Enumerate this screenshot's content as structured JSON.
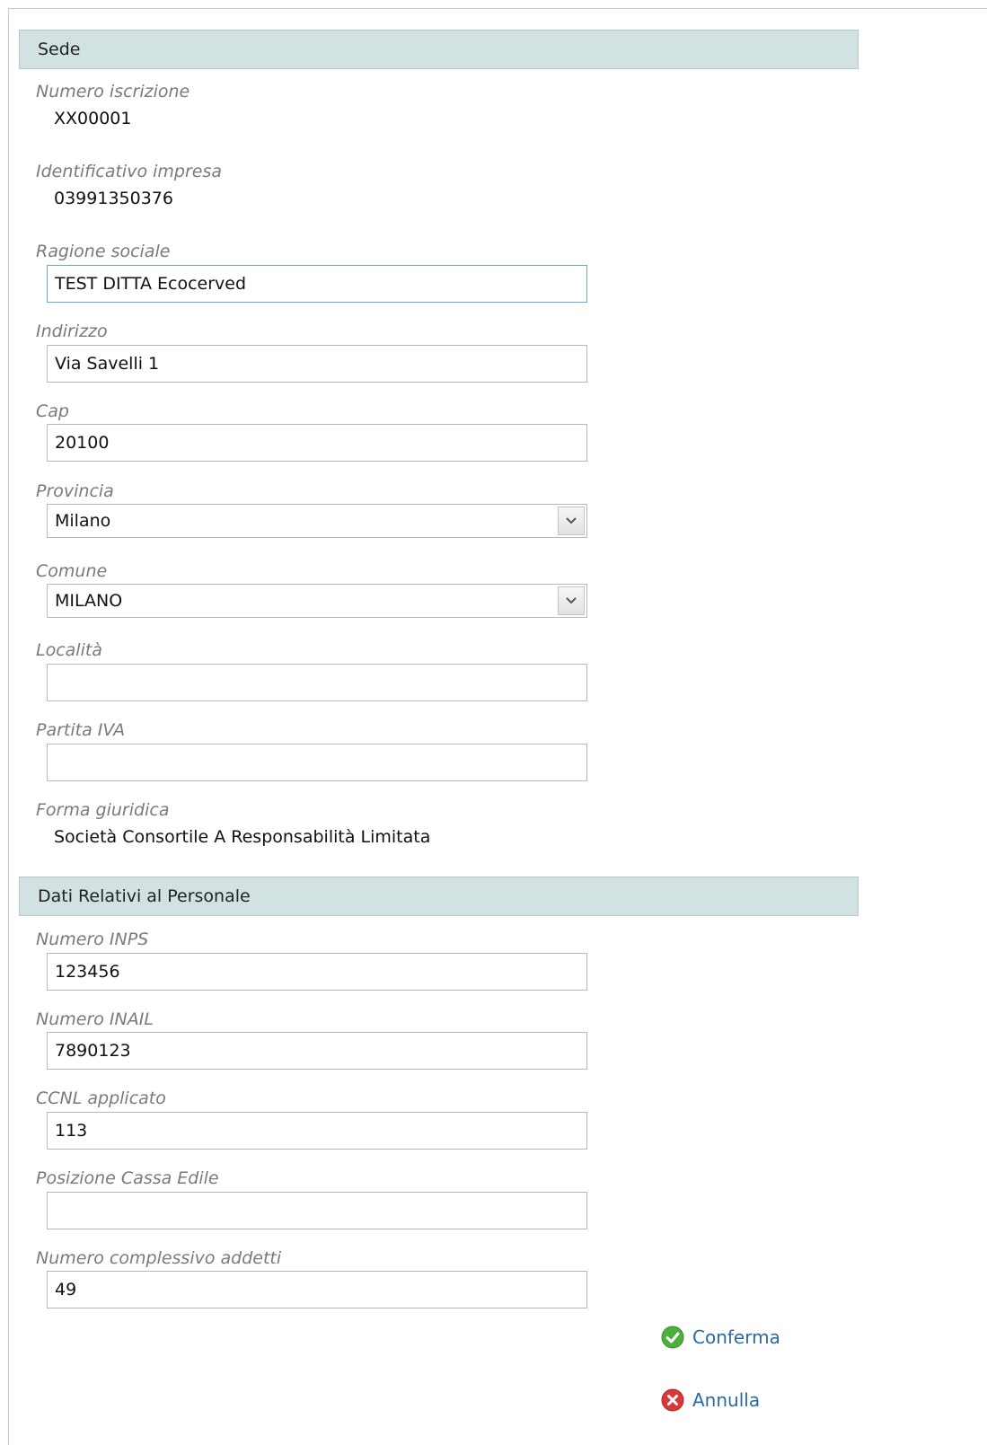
{
  "sede": {
    "header": "Sede",
    "numero_iscrizione": {
      "label": "Numero iscrizione",
      "value": "XX00001"
    },
    "identificativo_impresa": {
      "label": "Identificativo impresa",
      "value": "03991350376"
    },
    "ragione_sociale": {
      "label": "Ragione sociale",
      "value": "TEST DITTA Ecocerved"
    },
    "indirizzo": {
      "label": "Indirizzo",
      "value": "Via Savelli 1"
    },
    "cap": {
      "label": "Cap",
      "value": "20100"
    },
    "provincia": {
      "label": "Provincia",
      "selected": "Milano"
    },
    "comune": {
      "label": "Comune",
      "selected": "MILANO"
    },
    "localita": {
      "label": "Località",
      "value": ""
    },
    "partita_iva": {
      "label": "Partita IVA",
      "value": ""
    },
    "forma_giuridica": {
      "label": "Forma giuridica",
      "value": "Società Consortile A Responsabilità Limitata"
    }
  },
  "personale": {
    "header": "Dati Relativi al Personale",
    "numero_inps": {
      "label": "Numero INPS",
      "value": "123456"
    },
    "numero_inail": {
      "label": "Numero INAIL",
      "value": "7890123"
    },
    "ccnl_applicato": {
      "label": "CCNL applicato",
      "value": "113"
    },
    "posizione_cassa_edile": {
      "label": "Posizione Cassa Edile",
      "value": ""
    },
    "numero_complessivo_addetti": {
      "label": "Numero complessivo addetti",
      "value": "49"
    }
  },
  "actions": {
    "confirm": {
      "label": "Conferma",
      "icon": "check-circle-icon",
      "color": "#4caf3e"
    },
    "cancel": {
      "label": "Annulla",
      "icon": "close-circle-icon",
      "color": "#d9383a"
    }
  },
  "colors": {
    "section_header_bg": "#d2e2e2",
    "link": "#2b6aa3",
    "input_focus_border": "#6ea7d2"
  }
}
